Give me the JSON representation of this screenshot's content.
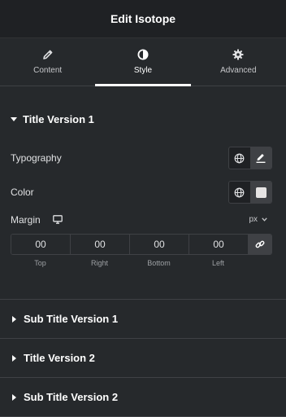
{
  "header": {
    "title": "Edit Isotope"
  },
  "tabs": [
    {
      "label": "Content",
      "icon": "pencil-icon",
      "active": false
    },
    {
      "label": "Style",
      "icon": "half-circle-icon",
      "active": true
    },
    {
      "label": "Advanced",
      "icon": "gear-icon",
      "active": false
    }
  ],
  "section_open": {
    "title": "Title Version 1",
    "typography": {
      "label": "Typography"
    },
    "color": {
      "label": "Color",
      "swatch": "#e6e4e4"
    },
    "margin": {
      "label": "Margin",
      "unit": "px",
      "values": [
        "00",
        "00",
        "00",
        "00"
      ],
      "labels": [
        "Top",
        "Right",
        "Bottom",
        "Left"
      ]
    }
  },
  "sections_collapsed": [
    {
      "title": "Sub Title Version 1"
    },
    {
      "title": "Title Version 2"
    },
    {
      "title": "Sub Title Version 2"
    }
  ],
  "colors": {
    "background": "#26292c",
    "header_bg": "#1f2124",
    "border": "#3f4145",
    "text": "#e0e1e3"
  }
}
